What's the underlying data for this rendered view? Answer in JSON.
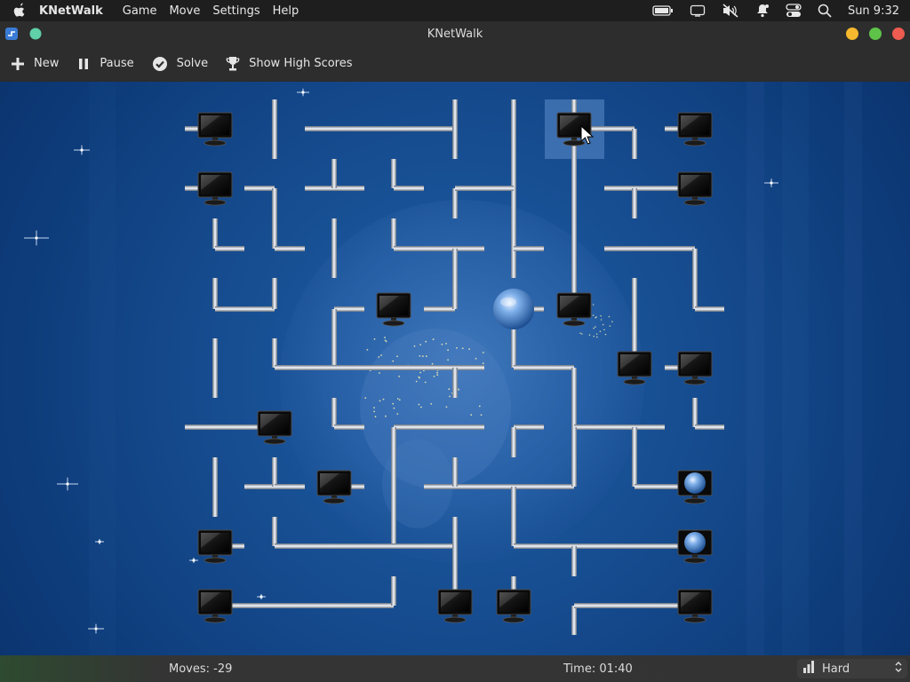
{
  "menubar": {
    "app_name": "KNetWalk",
    "menus": [
      "Game",
      "Move",
      "Settings",
      "Help"
    ],
    "clock": "Sun 9:32"
  },
  "window": {
    "title": "KNetWalk"
  },
  "toolbar": {
    "new_label": "New",
    "pause_label": "Pause",
    "solve_label": "Solve",
    "highscores_label": "Show High Scores"
  },
  "status": {
    "moves": "Moves: -29",
    "time": "Time: 01:40",
    "difficulty": "Hard"
  },
  "colors": {
    "menubar_bg": "#1e1e1e",
    "window_bg": "#2d2d2d",
    "board_blue": "#174e92",
    "pipe": "#c9ced6",
    "btn_yellow": "#f5b82e",
    "btn_green": "#5fc34a",
    "btn_red": "#ee5b50",
    "titlebar_dot": "#5fd0a8"
  }
}
